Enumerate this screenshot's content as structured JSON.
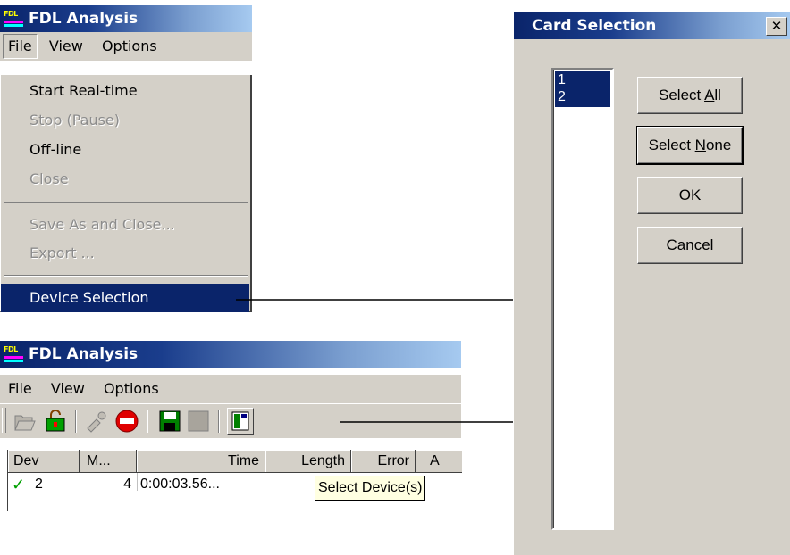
{
  "menu_window": {
    "title": "FDL Analysis",
    "icon_text": "FDL",
    "menubar": [
      "File",
      "View",
      "Options"
    ],
    "items": [
      {
        "label": "Start Real-time",
        "enabled": true
      },
      {
        "label": "Stop (Pause)",
        "enabled": false
      },
      {
        "label": "Off-line",
        "enabled": true
      },
      {
        "label": "Close",
        "enabled": false
      },
      {
        "label": "Save As and Close...",
        "enabled": false
      },
      {
        "label": "Export ...",
        "enabled": false
      },
      {
        "label": "Device Selection",
        "enabled": true,
        "selected": true
      }
    ]
  },
  "toolbar_window": {
    "title": "FDL Analysis",
    "icon_text": "FDL",
    "menubar": [
      "File",
      "View",
      "Options"
    ],
    "columns": [
      "Dev",
      "M...",
      "Time",
      "Length",
      "Error",
      "A"
    ],
    "row": {
      "dev": "2",
      "m": "4",
      "time": "0:00:03.56..."
    },
    "tooltip": "Select Device(s)"
  },
  "dialog": {
    "title": "Card Selection",
    "close_glyph": "✕",
    "list_items": [
      "1",
      "2"
    ],
    "buttons": {
      "select_all": {
        "pre": "Select ",
        "key": "A",
        "post": "ll"
      },
      "select_none": {
        "pre": "Select ",
        "key": "N",
        "post": "one"
      },
      "ok": "OK",
      "cancel": "Cancel"
    }
  },
  "colors": {
    "highlight": "#0a246a",
    "face": "#d4d0c8",
    "arrow": "#000000"
  }
}
